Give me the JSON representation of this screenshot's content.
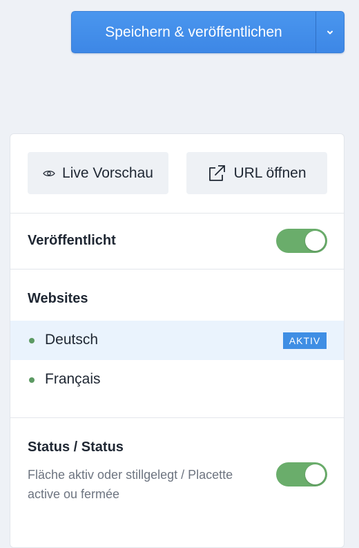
{
  "toolbar": {
    "publish_label": "Speichern & veröffentlichen",
    "dropdown_icon": "chevron-down-icon"
  },
  "actions": {
    "live_preview_label": "Live Vorschau",
    "live_preview_icon": "eye-icon",
    "open_url_label": "URL öffnen",
    "open_url_icon": "external-link-icon"
  },
  "published": {
    "label": "Veröffentlicht",
    "enabled": true
  },
  "websites": {
    "title": "Websites",
    "items": [
      {
        "label": "Deutsch",
        "badge": "AKTIV",
        "active": true
      },
      {
        "label": "Français",
        "badge": "",
        "active": false
      }
    ]
  },
  "status": {
    "title": "Status / Status",
    "description": "Fläche aktiv oder stillgelegt / Placette active ou fermée",
    "enabled": true
  },
  "colors": {
    "primary": "#3d87e6",
    "toggle_on": "#6aad6b",
    "dot": "#5c9a63",
    "active_row": "#eaf3fd",
    "badge": "#3f8ee4"
  }
}
